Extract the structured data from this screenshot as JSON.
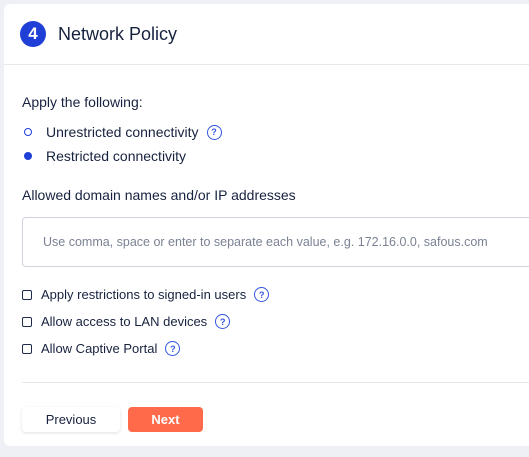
{
  "header": {
    "step_number": "4",
    "title": "Network Policy"
  },
  "connectivity": {
    "label": "Apply the following:",
    "options": [
      {
        "label": "Unrestricted connectivity",
        "selected": false
      },
      {
        "label": "Restricted connectivity",
        "selected": true
      }
    ]
  },
  "domains": {
    "label": "Allowed domain names and/or IP addresses",
    "placeholder": "Use comma, space or enter to separate each value, e.g. 172.16.0.0, safous.com",
    "value": ""
  },
  "checkboxes": [
    {
      "label": "Apply restrictions to signed-in users",
      "checked": false
    },
    {
      "label": "Allow access to LAN devices",
      "checked": false
    },
    {
      "label": "Allow Captive Portal",
      "checked": false
    }
  ],
  "help_glyph": "?",
  "footer": {
    "previous_label": "Previous",
    "next_label": "Next"
  },
  "colors": {
    "accent": "#1f3fd6",
    "next_button": "#ff6b4a"
  },
  "icons": {
    "help": "question-circle-icon"
  }
}
